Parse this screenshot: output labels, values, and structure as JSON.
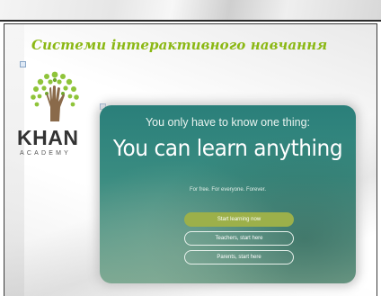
{
  "slide": {
    "title": "Системи інтерактивного навчання"
  },
  "logo": {
    "name": "KHAN",
    "subtitle": "ACADEMY"
  },
  "hero": {
    "line1": "You only have to know one thing:",
    "headline": "You can learn anything",
    "tagline": "For free. For everyone. Forever.",
    "buttons": {
      "start": "Start learning now",
      "teachers": "Teachers, start here",
      "parents": "Parents, start here"
    }
  },
  "colors": {
    "title": "#8bb814",
    "hero": "#3a8c81",
    "primary_button": "#9cb04a",
    "tree_leaves": "#8fc43a",
    "tree_hand": "#8a6a4a"
  }
}
